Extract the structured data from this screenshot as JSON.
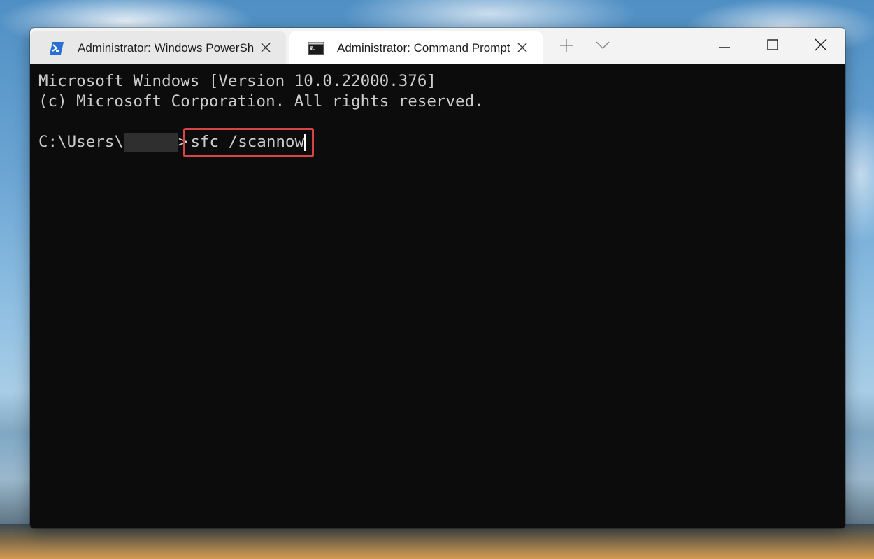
{
  "tabs": [
    {
      "title": "Administrator: Windows PowerShell",
      "icon": "powershell-icon",
      "active": false
    },
    {
      "title": "Administrator: Command Prompt",
      "icon": "command-prompt-icon",
      "active": true
    }
  ],
  "titlebar": {
    "new_tab_icon": "plus-icon",
    "dropdown_icon": "chevron-down-icon",
    "window_buttons": [
      "minimize-icon",
      "maximize-icon",
      "close-icon"
    ]
  },
  "terminal": {
    "line1": "Microsoft Windows [Version 10.0.22000.376]",
    "line2": "(c) Microsoft Corporation. All rights reserved.",
    "prompt": "C:\\Users\\",
    "prompt_suffix": ">",
    "command": "sfc /scannow"
  },
  "colors": {
    "terminal_bg": "#0c0c0c",
    "terminal_fg": "#cccccc",
    "highlight": "#d64545",
    "powershell_blue": "#2a6fd6"
  }
}
